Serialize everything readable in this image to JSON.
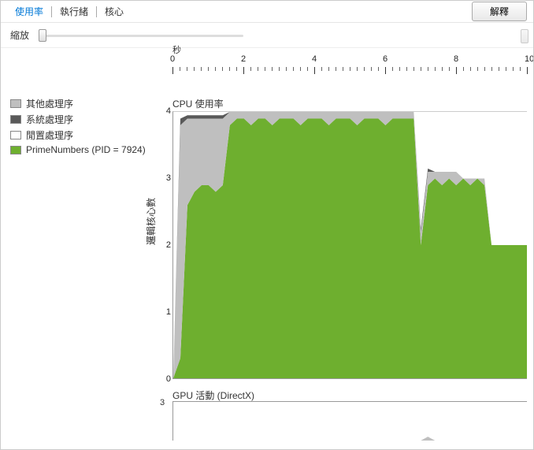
{
  "tabs": [
    "使用率",
    "執行緒",
    "核心"
  ],
  "buttons": {
    "explain": "解釋"
  },
  "zoom": {
    "label": "縮放"
  },
  "legend": [
    {
      "label": "其他處理序",
      "color": "#bfbfbf"
    },
    {
      "label": "系統處理序",
      "color": "#595959"
    },
    {
      "label": "閒置處理序",
      "color": "#ffffff"
    },
    {
      "label": "PrimeNumbers (PID = 7924)",
      "color": "#6eaf2f"
    }
  ],
  "chart_data": {
    "cpu": {
      "type": "area",
      "title": "CPU 使用率",
      "x_unit": "秒",
      "xlabel": "",
      "ylabel": "邏輯核心數",
      "xlim": [
        0,
        10
      ],
      "ylim": [
        0,
        4
      ],
      "x_ticks": [
        0,
        2,
        4,
        6,
        8,
        10
      ],
      "y_ticks": [
        0,
        1,
        2,
        3,
        4
      ],
      "minor_tick_interval": 0.2,
      "x": [
        0.0,
        0.2,
        0.4,
        0.6,
        0.8,
        1.0,
        1.2,
        1.4,
        1.6,
        1.8,
        2.0,
        2.2,
        2.4,
        2.6,
        2.8,
        3.0,
        3.2,
        3.4,
        3.6,
        3.8,
        4.0,
        4.2,
        4.4,
        4.6,
        4.8,
        5.0,
        5.2,
        5.4,
        5.6,
        5.8,
        6.0,
        6.2,
        6.4,
        6.6,
        6.8,
        7.0,
        7.2,
        7.4,
        7.6,
        7.8,
        8.0,
        8.2,
        8.4,
        8.6,
        8.8,
        9.0,
        9.2,
        9.4,
        9.6,
        9.8,
        10.0
      ],
      "series": [
        {
          "name": "PrimeNumbers",
          "color": "#6eaf2f",
          "values": [
            0.0,
            0.3,
            2.6,
            2.8,
            2.9,
            2.9,
            2.8,
            2.9,
            3.8,
            3.9,
            3.9,
            3.8,
            3.9,
            3.9,
            3.8,
            3.9,
            3.9,
            3.9,
            3.8,
            3.9,
            3.9,
            3.9,
            3.8,
            3.9,
            3.9,
            3.9,
            3.8,
            3.9,
            3.9,
            3.9,
            3.8,
            3.9,
            3.9,
            3.9,
            3.9,
            2.0,
            2.9,
            3.0,
            2.9,
            3.0,
            2.9,
            3.0,
            2.9,
            3.0,
            2.9,
            2.0,
            2.0,
            2.0,
            2.0,
            2.0,
            2.0
          ]
        },
        {
          "name": "其他處理序",
          "color": "#bfbfbf",
          "values": [
            0.0,
            3.5,
            1.3,
            1.1,
            1.0,
            1.0,
            1.1,
            1.0,
            0.2,
            0.1,
            0.1,
            0.2,
            0.1,
            0.1,
            0.2,
            0.1,
            0.1,
            0.1,
            0.2,
            0.1,
            0.1,
            0.1,
            0.2,
            0.1,
            0.1,
            0.1,
            0.2,
            0.1,
            0.1,
            0.1,
            0.2,
            0.1,
            0.1,
            0.1,
            0.1,
            0.2,
            0.2,
            0.1,
            0.2,
            0.1,
            0.2,
            0.0,
            0.1,
            0.0,
            0.1,
            0.0,
            0.0,
            0.0,
            0.0,
            0.0,
            0.0
          ]
        },
        {
          "name": "系統處理序",
          "color": "#595959",
          "values": [
            0.0,
            0.1,
            0.05,
            0.05,
            0.05,
            0.05,
            0.05,
            0.05,
            0.0,
            0.0,
            0.0,
            0.0,
            0.0,
            0.0,
            0.0,
            0.0,
            0.0,
            0.0,
            0.0,
            0.0,
            0.0,
            0.0,
            0.0,
            0.0,
            0.0,
            0.0,
            0.0,
            0.0,
            0.0,
            0.0,
            0.0,
            0.0,
            0.0,
            0.0,
            0.0,
            0.05,
            0.05,
            0.0,
            0.0,
            0.0,
            0.0,
            0.0,
            0.0,
            0.0,
            0.0,
            0.0,
            0.0,
            0.0,
            0.0,
            0.0,
            0.0
          ]
        }
      ]
    },
    "gpu": {
      "type": "area",
      "title": "GPU 活動 (DirectX)",
      "ylim": [
        0,
        3
      ],
      "y_ticks": [
        3
      ],
      "x": [
        0.0,
        1.0,
        2.0,
        3.0,
        4.0,
        5.0,
        6.0,
        7.0,
        7.2,
        7.4,
        8.0,
        9.0,
        10.0
      ],
      "series": [
        {
          "name": "GPU",
          "color": "#bfbfbf",
          "values": [
            0.0,
            0.0,
            0.0,
            0.0,
            0.0,
            0.0,
            0.0,
            0.0,
            0.3,
            0.0,
            0.0,
            0.0,
            0.0
          ]
        }
      ]
    }
  }
}
